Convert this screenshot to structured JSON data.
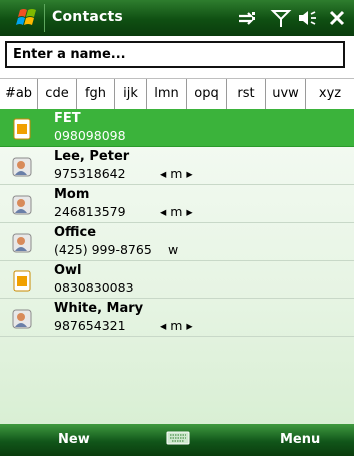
{
  "title_bar": {
    "title": "Contacts",
    "icons": [
      "windows-start-icon",
      "connectivity-icon",
      "signal-icon",
      "volume-icon",
      "close-icon"
    ]
  },
  "search": {
    "placeholder": "Enter a name..."
  },
  "letter_tabs": [
    "#ab",
    "cde",
    "fgh",
    "ijk",
    "lmn",
    "opq",
    "rst",
    "uvw",
    "xyz"
  ],
  "contacts": [
    {
      "name": "FET",
      "number": "098098098",
      "tag": "",
      "type": "sim",
      "selected": true
    },
    {
      "name": "Lee, Peter",
      "number": "975318642",
      "tag": "◂ m ▸",
      "type": "person",
      "selected": false
    },
    {
      "name": "Mom",
      "number": "246813579",
      "tag": "◂ m ▸",
      "type": "person",
      "selected": false
    },
    {
      "name": "Office",
      "number": "(425) 999-8765",
      "tag": "w",
      "type": "person",
      "selected": false
    },
    {
      "name": "Owl",
      "number": "0830830083",
      "tag": "",
      "type": "sim",
      "selected": false
    },
    {
      "name": "White, Mary",
      "number": "987654321",
      "tag": "◂ m ▸",
      "type": "person",
      "selected": false
    }
  ],
  "soft_keys": {
    "left": "New",
    "right": "Menu",
    "center_icon": "keyboard-icon"
  },
  "colors": {
    "title_bar": "#0f4f12",
    "selection": "#3bb33b",
    "list_background": "#e6f4e3"
  }
}
